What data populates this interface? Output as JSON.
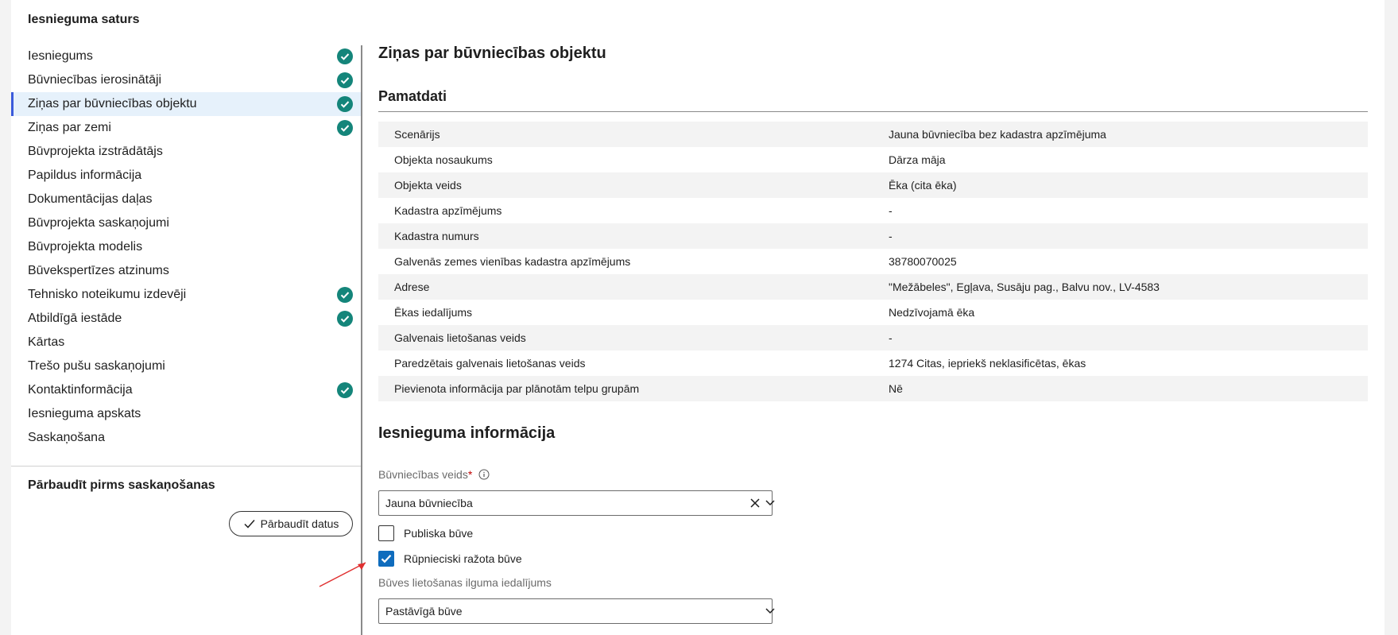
{
  "sidebar": {
    "title": "Iesnieguma saturs",
    "items": [
      {
        "label": "Iesniegums",
        "done": true
      },
      {
        "label": "Būvniecības ierosinātāji",
        "done": true
      },
      {
        "label": "Ziņas par būvniecības objektu",
        "done": true,
        "active": true
      },
      {
        "label": "Ziņas par zemi",
        "done": true
      },
      {
        "label": "Būvprojekta izstrādātājs",
        "done": false
      },
      {
        "label": "Papildus informācija",
        "done": false
      },
      {
        "label": "Dokumentācijas daļas",
        "done": false
      },
      {
        "label": "Būvprojekta saskaņojumi",
        "done": false
      },
      {
        "label": "Būvprojekta modelis",
        "done": false
      },
      {
        "label": "Būvekspertīzes atzinums",
        "done": false
      },
      {
        "label": "Tehnisko noteikumu izdevēji",
        "done": true
      },
      {
        "label": "Atbildīgā iestāde",
        "done": true
      },
      {
        "label": "Kārtas",
        "done": false
      },
      {
        "label": "Trešo pušu saskaņojumi",
        "done": false
      },
      {
        "label": "Kontaktinformācija",
        "done": true
      },
      {
        "label": "Iesnieguma apskats",
        "done": false
      },
      {
        "label": "Saskaņošana",
        "done": false
      }
    ],
    "verify_title": "Pārbaudīt pirms saskaņošanas",
    "verify_button": "Pārbaudīt datus"
  },
  "main": {
    "title": "Ziņas par būvniecības objektu",
    "basic_section": "Pamatdati",
    "basic_rows": [
      {
        "key": "Scenārijs",
        "value": "Jauna būvniecība bez kadastra apzīmējuma"
      },
      {
        "key": "Objekta nosaukums",
        "value": "Dārza māja"
      },
      {
        "key": "Objekta veids",
        "value": "Ēka (cita ēka)"
      },
      {
        "key": "Kadastra apzīmējums",
        "value": "-"
      },
      {
        "key": "Kadastra numurs",
        "value": "-"
      },
      {
        "key": "Galvenās zemes vienības kadastra apzīmējums",
        "value": "38780070025"
      },
      {
        "key": "Adrese",
        "value": "\"Mežābeles\", Egļava, Susāju pag., Balvu nov., LV-4583"
      },
      {
        "key": "Ēkas iedalījums",
        "value": "Nedzīvojamā ēka"
      },
      {
        "key": "Galvenais lietošanas veids",
        "value": "-"
      },
      {
        "key": "Paredzētais galvenais lietošanas veids",
        "value": "1274 Citas, iepriekš neklasificētas, ēkas"
      },
      {
        "key": "Pievienota informācija par plānotām telpu grupām",
        "value": "Nē"
      }
    ],
    "application_section": "Iesnieguma informācija",
    "construction_type_label": "Būvniecības veids",
    "required_mark": "*",
    "construction_type_value": "Jauna būvniecība",
    "public_building_label": "Publiska būve",
    "public_building_checked": false,
    "industrial_label": "Rūpnieciski ražota būve",
    "industrial_checked": true,
    "usage_duration_label": "Būves lietošanas ilguma iedalījums",
    "usage_duration_value": "Pastāvīgā būve"
  },
  "colors": {
    "check": "#14857a",
    "checkbox": "#0f6cbd",
    "annotation_arrow": "#e03030"
  }
}
